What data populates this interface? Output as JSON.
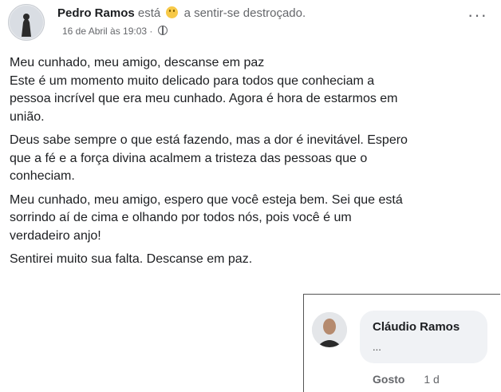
{
  "post": {
    "author": "Pedro Ramos",
    "activity_prefix": "está",
    "feeling_icon": "sad-emoji-icon",
    "activity_suffix": "a sentir-se destroçado.",
    "timestamp": "16 de Abril às 19:03",
    "separator": "·",
    "audience_icon": "globe-icon",
    "more_icon": "···",
    "paragraphs": [
      [
        "Meu cunhado, meu amigo, descanse em paz",
        "Este é um momento muito delicado para todos que conheciam a",
        "pessoa incrível que era meu cunhado. Agora é hora de estarmos em",
        "união."
      ],
      [
        "Deus sabe sempre o que está fazendo, mas a dor é inevitável. Espero",
        "que a fé e a força divina acalmem a tristeza das pessoas que o",
        "conheciam."
      ],
      [
        "Meu cunhado, meu amigo, espero que você esteja bem. Sei que está",
        "sorrindo aí de cima e olhando por todos nós, pois você é um",
        "verdadeiro anjo!"
      ],
      [
        "Sentirei muito sua falta. Descanse em paz."
      ]
    ]
  },
  "comment": {
    "author": "Cláudio Ramos",
    "text": "...",
    "like_label": "Gosto",
    "age": "1 d"
  }
}
